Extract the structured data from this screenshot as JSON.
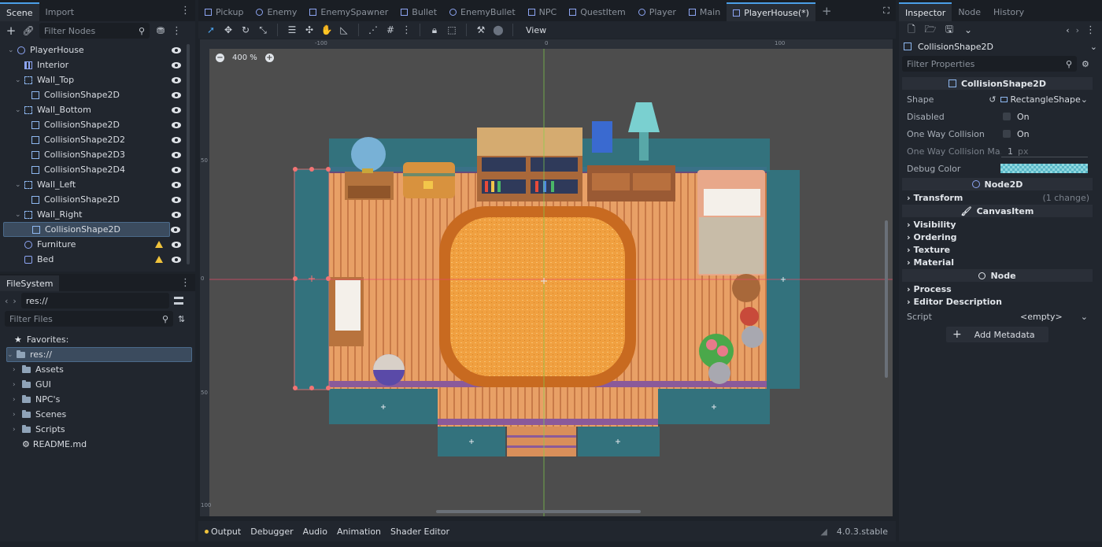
{
  "scene_panel": {
    "tabs": [
      "Scene",
      "Import"
    ],
    "filter_placeholder": "Filter Nodes",
    "nodes": [
      {
        "label": "PlayerHouse",
        "icon": "node2d-icon",
        "depth": 0,
        "warn": false
      },
      {
        "label": "Interior",
        "icon": "tilemap-icon",
        "depth": 1,
        "warn": false
      },
      {
        "label": "Wall_Top",
        "icon": "staticbody-icon",
        "depth": 1,
        "warn": false
      },
      {
        "label": "CollisionShape2D",
        "icon": "collisionshape-icon",
        "depth": 2,
        "warn": false
      },
      {
        "label": "Wall_Bottom",
        "icon": "staticbody-icon",
        "depth": 1,
        "warn": false
      },
      {
        "label": "CollisionShape2D",
        "icon": "collisionshape-icon",
        "depth": 2,
        "warn": false
      },
      {
        "label": "CollisionShape2D2",
        "icon": "collisionshape-icon",
        "depth": 2,
        "warn": false
      },
      {
        "label": "CollisionShape2D3",
        "icon": "collisionshape-icon",
        "depth": 2,
        "warn": false
      },
      {
        "label": "CollisionShape2D4",
        "icon": "collisionshape-icon",
        "depth": 2,
        "warn": false
      },
      {
        "label": "Wall_Left",
        "icon": "staticbody-icon",
        "depth": 1,
        "warn": false
      },
      {
        "label": "CollisionShape2D",
        "icon": "collisionshape-icon",
        "depth": 2,
        "warn": false
      },
      {
        "label": "Wall_Right",
        "icon": "staticbody-icon",
        "depth": 1,
        "warn": false
      },
      {
        "label": "CollisionShape2D",
        "icon": "collisionshape-icon",
        "depth": 2,
        "warn": false
      },
      {
        "label": "Furniture",
        "icon": "node2d-icon",
        "depth": 1,
        "warn": true
      },
      {
        "label": "Bed",
        "icon": "sprite-icon",
        "depth": 1,
        "warn": true
      }
    ]
  },
  "filesystem": {
    "tab": "FileSystem",
    "path": "res://",
    "filter_placeholder": "Filter Files",
    "favorites_label": "Favorites:",
    "root_label": "res://",
    "items": [
      {
        "label": "Assets",
        "type": "folder"
      },
      {
        "label": "GUI",
        "type": "folder"
      },
      {
        "label": "NPC's",
        "type": "folder"
      },
      {
        "label": "Scenes",
        "type": "folder"
      },
      {
        "label": "Scripts",
        "type": "folder"
      },
      {
        "label": "README.md",
        "type": "file"
      }
    ]
  },
  "editor_tabs": [
    "Pickup",
    "Enemy",
    "EnemySpawner",
    "Bullet",
    "EnemyBullet",
    "NPC",
    "QuestItem",
    "Player",
    "Main",
    "PlayerHouse(*)"
  ],
  "active_editor_tab": "PlayerHouse(*)",
  "toolbar": {
    "view_label": "View"
  },
  "viewport": {
    "zoom_label": "400 %",
    "ruler_h": [
      "-100",
      "0",
      "100"
    ],
    "ruler_v": [
      "50",
      "0",
      "50",
      "100"
    ]
  },
  "bottom_panel": {
    "tabs": [
      "Output",
      "Debugger",
      "Audio",
      "Animation",
      "Shader Editor"
    ],
    "version": "4.0.3.stable"
  },
  "inspector": {
    "tabs": [
      "Inspector",
      "Node",
      "History"
    ],
    "object_name": "CollisionShape2D",
    "filter_placeholder": "Filter Properties",
    "section_title": "CollisionShape2D",
    "props": {
      "shape_label": "Shape",
      "shape_value": "RectangleShape",
      "disabled_label": "Disabled",
      "disabled_value": "On",
      "oneway_label": "One Way Collision",
      "oneway_value": "On",
      "margin_label": "One Way Collision Ma...",
      "margin_value": "1",
      "margin_unit": "px",
      "debug_label": "Debug Color"
    },
    "node2d_title": "Node2D",
    "transform_label": "Transform",
    "transform_note": "(1 change)",
    "canvasitem_title": "CanvasItem",
    "canvas_groups": [
      "Visibility",
      "Ordering",
      "Texture",
      "Material"
    ],
    "node_title": "Node",
    "node_groups": [
      "Process",
      "Editor Description"
    ],
    "script_label": "Script",
    "script_value": "<empty>",
    "add_metadata": "Add Metadata"
  },
  "colors": {
    "accent": "#4b9fe8",
    "collision": "#2b7f8e",
    "floor": "#e8a066",
    "rug": "#f0a040",
    "warning": "#f0c33c"
  }
}
